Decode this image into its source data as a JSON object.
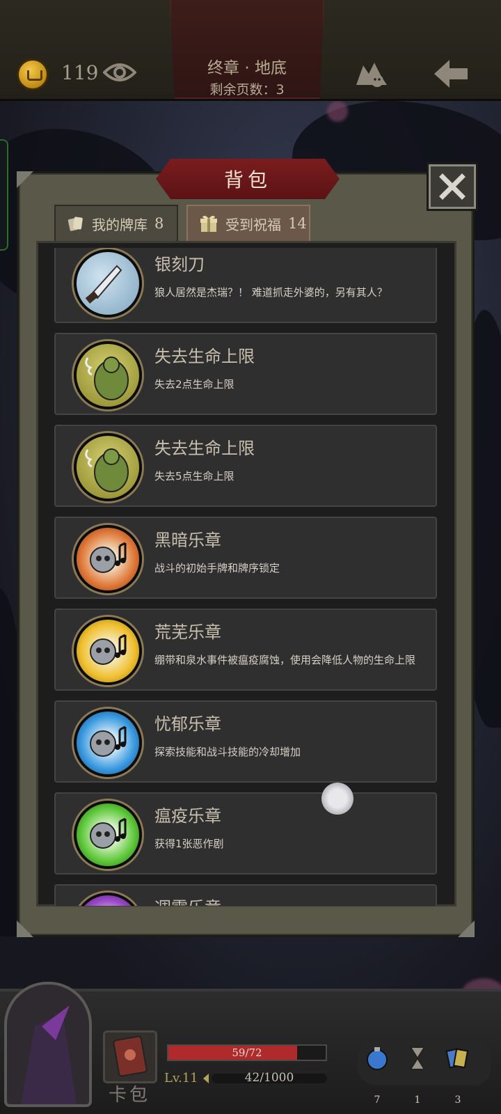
{
  "topbar": {
    "coins": "119",
    "chapter_title": "终章 · 地底",
    "pages_left": "剩余页数：3"
  },
  "panel": {
    "title": "背包",
    "tabs": [
      {
        "label": "我的牌库",
        "count": "8"
      },
      {
        "label": "受到祝福",
        "count": "14"
      }
    ]
  },
  "items": [
    {
      "name": "银刻刀",
      "desc": "狼人居然是杰瑞？！ 难道抓走外婆的，另有其人？",
      "icon": "knife-icon",
      "color": "#9fbfd6"
    },
    {
      "name": "失去生命上限",
      "desc": "失去2点生命上限",
      "icon": "ogre-icon",
      "color": "#b3b04a"
    },
    {
      "name": "失去生命上限",
      "desc": "失去5点生命上限",
      "icon": "ogre-icon",
      "color": "#b3b04a"
    },
    {
      "name": "黑暗乐章",
      "desc": "战斗的初始手牌和牌序锁定",
      "icon": "music-skull-icon",
      "color": "#e07a3a"
    },
    {
      "name": "荒芜乐章",
      "desc": "绷带和泉水事件被瘟疫腐蚀，使用会降低人物的生命上限",
      "icon": "music-skull-icon",
      "color": "#f0c030"
    },
    {
      "name": "忧郁乐章",
      "desc": "探索技能和战斗技能的冷却增加",
      "icon": "music-skull-icon",
      "color": "#3a9ae0"
    },
    {
      "name": "瘟疫乐章",
      "desc": "获得1张恶作剧",
      "icon": "music-skull-icon",
      "color": "#5ec83a"
    },
    {
      "name": "凋零乐章",
      "desc": "",
      "icon": "music-skull-icon",
      "color": "#9a4ac8"
    }
  ],
  "status": {
    "hp": "59/72",
    "hp_fraction": 0.82,
    "level": "Lv.11",
    "xp": "42/1000",
    "card_label": "卡包",
    "resources": [
      "7",
      "1",
      "3"
    ]
  }
}
